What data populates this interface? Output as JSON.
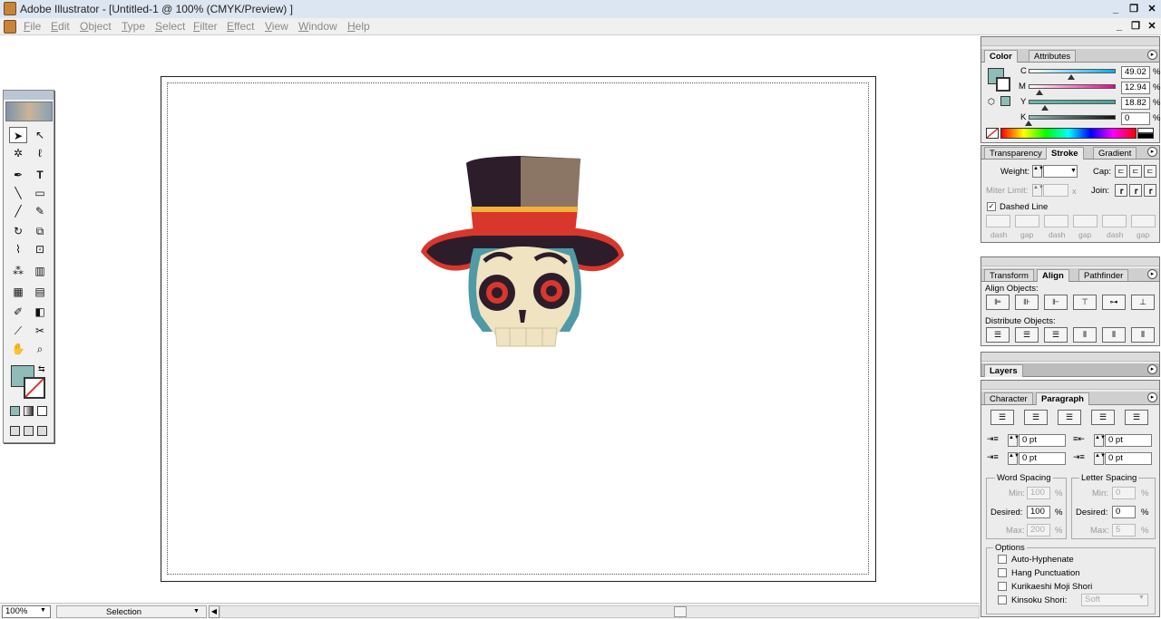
{
  "window": {
    "title": "Adobe Illustrator - [Untitled-1 @ 100% (CMYK/Preview) ]"
  },
  "menu": [
    "File",
    "Edit",
    "Object",
    "Type",
    "Select",
    "Filter",
    "Effect",
    "View",
    "Window",
    "Help"
  ],
  "window_controls": {
    "minimize": "_",
    "restore": "❐",
    "close": "✕"
  },
  "color_panel": {
    "tabs": [
      "Color",
      "Attributes"
    ],
    "channels": [
      {
        "label": "C",
        "value": "49.02",
        "unit": "%",
        "level": 0.49
      },
      {
        "label": "M",
        "value": "12.94",
        "unit": "%",
        "level": 0.13
      },
      {
        "label": "Y",
        "value": "18.82",
        "unit": "%",
        "level": 0.19
      },
      {
        "label": "K",
        "value": "0",
        "unit": "%",
        "level": 0.0
      }
    ],
    "fill_color": "#8fbcb8"
  },
  "stroke_panel": {
    "tabs": [
      "Transparency",
      "Stroke",
      "Gradient"
    ],
    "weight_label": "Weight:",
    "cap_label": "Cap:",
    "miter_label": "Miter Limit:",
    "miter_x": "x",
    "join_label": "Join:",
    "dashed_label": "Dashed Line",
    "dash_labels": [
      "dash",
      "gap",
      "dash",
      "gap",
      "dash",
      "gap"
    ]
  },
  "align_panel": {
    "tabs": [
      "Transform",
      "Align",
      "Pathfinder"
    ],
    "align_objects": "Align Objects:",
    "distribute_objects": "Distribute Objects:"
  },
  "layers_panel": {
    "title": "Layers"
  },
  "paragraph_panel": {
    "tabs": [
      "Character",
      "Paragraph"
    ],
    "indent_values": [
      "0 pt",
      "0 pt",
      "0 pt",
      "0 pt"
    ],
    "word_spacing": {
      "title": "Word Spacing",
      "min_label": "Min:",
      "min": "100",
      "desired_label": "Desired:",
      "desired": "100",
      "max_label": "Max:",
      "max": "200",
      "unit": "%"
    },
    "letter_spacing": {
      "title": "Letter Spacing",
      "min_label": "Min:",
      "min": "0",
      "desired_label": "Desired:",
      "desired": "0",
      "max_label": "Max:",
      "max": "5",
      "unit": "%"
    },
    "options": {
      "title": "Options",
      "items": [
        "Auto-Hyphenate",
        "Hang Punctuation",
        "Kurikaeshi Moji Shori",
        "Kinsoku Shori:"
      ],
      "kinsoku_value": "Soft"
    }
  },
  "status": {
    "zoom": "100%",
    "mode": "Selection"
  },
  "colors": {
    "accent": "#8fbcb8",
    "hat_band": "#d9372b",
    "hat_dark": "#2d1d2b",
    "hat_light": "#8b7565",
    "skull": "#f0e3c2",
    "skull_side": "#4f9aa5",
    "eye": "#d9372b"
  }
}
